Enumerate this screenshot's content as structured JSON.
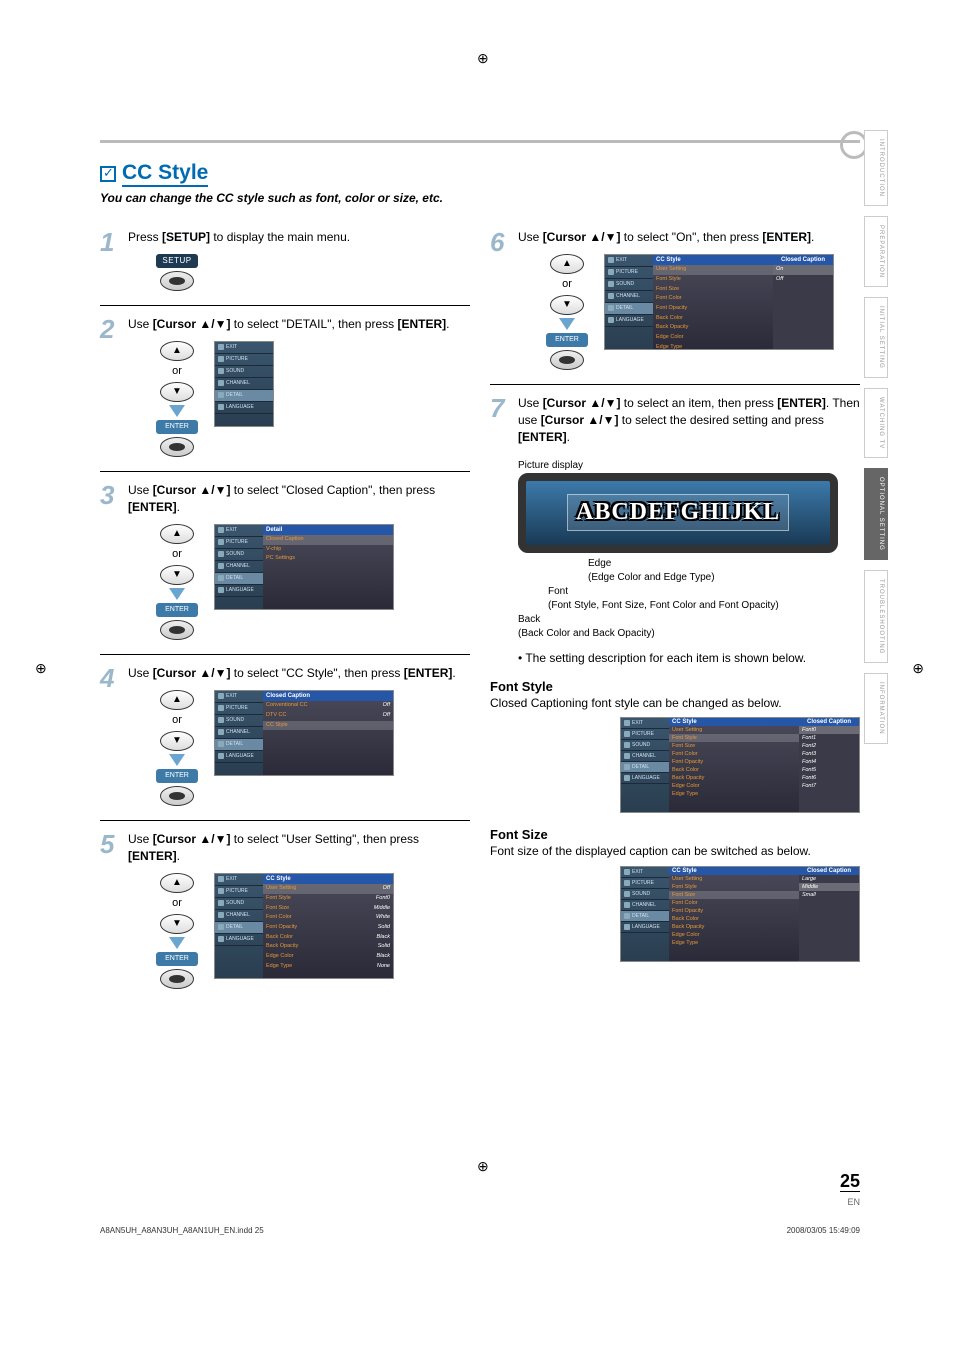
{
  "title": "CC Style",
  "subtitle": "You can change the CC style such as font, color or size, etc.",
  "steps": {
    "s1": {
      "num": "1",
      "text_a": "Press ",
      "key": "[SETUP]",
      "text_b": " to display the main menu."
    },
    "s2": {
      "num": "2",
      "text_a": "Use ",
      "key": "[Cursor ▲/▼]",
      "text_b": " to select \"DETAIL\", then press ",
      "key2": "[ENTER]",
      "text_c": "."
    },
    "s3": {
      "num": "3",
      "text_a": "Use ",
      "key": "[Cursor ▲/▼]",
      "text_b": " to select \"Closed Caption\", then press ",
      "key2": "[ENTER]",
      "text_c": "."
    },
    "s4": {
      "num": "4",
      "text_a": "Use ",
      "key": "[Cursor ▲/▼]",
      "text_b": " to select \"CC Style\", then press ",
      "key2": "[ENTER]",
      "text_c": "."
    },
    "s5": {
      "num": "5",
      "text_a": "Use ",
      "key": "[Cursor ▲/▼]",
      "text_b": " to select \"User Setting\", then press ",
      "key2": "[ENTER]",
      "text_c": "."
    },
    "s6": {
      "num": "6",
      "text_a": "Use ",
      "key": "[Cursor ▲/▼]",
      "text_b": " to select \"On\", then press ",
      "key2": "[ENTER]",
      "text_c": "."
    },
    "s7": {
      "num": "7",
      "text_a": "Use ",
      "key": "[Cursor ▲/▼]",
      "text_b": " to select an item, then press ",
      "key2": "[ENTER]",
      "text_c": ". Then use ",
      "key3": "[Cursor ▲/▼]",
      "text_d": " to select the desired setting and press ",
      "key4": "[ENTER]",
      "text_e": "."
    }
  },
  "remote": {
    "setup": "SETUP",
    "enter": "ENTER",
    "or": "or"
  },
  "osd": {
    "sidebar": [
      "EXIT",
      "PICTURE",
      "SOUND",
      "CHANNEL",
      "DETAIL",
      "LANGUAGE"
    ],
    "detail_header": "Detail",
    "detail_items": [
      "Closed Caption",
      "V-chip",
      "PC Settings"
    ],
    "cc_header": "Closed Caption",
    "cc_rows": [
      {
        "label": "Conventional CC",
        "val": "Off"
      },
      {
        "label": "DTV CC",
        "val": "Off"
      },
      {
        "label": "CC Style",
        "val": ""
      }
    ],
    "ccstyle_header": "CC Style",
    "ccstyle_rows": [
      {
        "label": "User Setting",
        "val": "Off"
      },
      {
        "label": "Font Style",
        "val": "Font0"
      },
      {
        "label": "Font Size",
        "val": "Middle"
      },
      {
        "label": "Font Color",
        "val": "White"
      },
      {
        "label": "Font Opacity",
        "val": "Solid"
      },
      {
        "label": "Back Color",
        "val": "Black"
      },
      {
        "label": "Back Opacity",
        "val": "Solid"
      },
      {
        "label": "Edge Color",
        "val": "Black"
      },
      {
        "label": "Edge Type",
        "val": "None"
      }
    ],
    "badge_closed_caption": "Closed Caption",
    "on_rows": [
      {
        "label": "User Setting",
        "val": ""
      },
      {
        "label": "Font Style",
        "val": ""
      },
      {
        "label": "Font Size",
        "val": ""
      },
      {
        "label": "Font Color",
        "val": ""
      },
      {
        "label": "Font Opacity",
        "val": ""
      },
      {
        "label": "Back Color",
        "val": ""
      },
      {
        "label": "Back Opacity",
        "val": ""
      },
      {
        "label": "Edge Color",
        "val": ""
      },
      {
        "label": "Edge Type",
        "val": ""
      }
    ],
    "on_vals": [
      "On",
      "Off"
    ],
    "fontstyle_vals": [
      "Font0",
      "Font1",
      "Font2",
      "Font3",
      "Font4",
      "Font5",
      "Font6",
      "Font7"
    ],
    "fontsize_vals": [
      "Large",
      "Middle",
      "Small"
    ]
  },
  "pd": {
    "label": "Picture display",
    "sample": "ABCDEFGHIJKL",
    "edge_label": "Edge",
    "edge_desc": "(Edge Color and Edge Type)",
    "font_label": "Font",
    "font_desc": "(Font Style, Font Size, Font Color and Font Opacity)",
    "back_label": "Back",
    "back_desc": "(Back Color and Back Opacity)"
  },
  "bullet": "•  The setting description for each item is shown below.",
  "sections": {
    "fontstyle": {
      "title": "Font Style",
      "text": "Closed Captioning font style can be changed as below."
    },
    "fontsize": {
      "title": "Font Size",
      "text": "Font size of the displayed caption can be switched as below."
    }
  },
  "side_tabs": [
    "INTRODUCTION",
    "PREPARATION",
    "INITIAL SETTING",
    "WATCHING TV",
    "OPTIONAL SETTING",
    "TROUBLESHOOTING",
    "INFORMATION"
  ],
  "active_tab_index": 4,
  "page_num": "25",
  "page_lang": "EN",
  "footer_left": "A8AN5UH_A8AN3UH_A8AN1UH_EN.indd   25",
  "footer_right": "2008/03/05   15:49:09"
}
